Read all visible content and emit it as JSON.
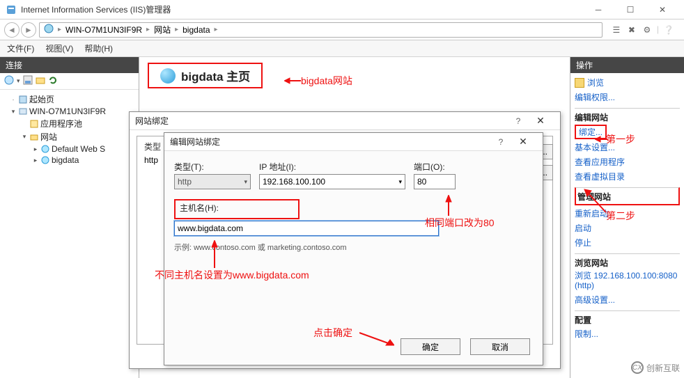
{
  "window": {
    "title": "Internet Information Services (IIS)管理器"
  },
  "breadcrumbs": {
    "server": "WIN-O7M1UN3IF9R",
    "sites": "网站",
    "site": "bigdata"
  },
  "menu": {
    "file": "文件(F)",
    "view": "视图(V)",
    "help": "帮助(H)"
  },
  "left": {
    "header": "连接",
    "start_page": "起始页",
    "server": "WIN-O7M1UN3IF9R",
    "app_pools": "应用程序池",
    "sites": "网站",
    "default_site": "Default Web S",
    "bigdata": "bigdata"
  },
  "center": {
    "title": "bigdata 主页"
  },
  "right": {
    "header": "操作",
    "explore": "浏览",
    "edit_perm": "编辑权限...",
    "grp_edit_site": "编辑网站",
    "bindings": "绑定...",
    "basic_settings": "基本设置...",
    "view_apps": "查看应用程序",
    "view_vdirs": "查看虚拟目录",
    "grp_manage": "管理网站",
    "restart": "重新启动",
    "start": "启动",
    "stop": "停止",
    "grp_browse": "浏览网站",
    "browse_url": "浏览 192.168.100.100:8080 (http)",
    "adv_settings": "高级设置...",
    "grp_config": "配置",
    "limits": "限制..."
  },
  "dlg_bindings": {
    "title": "网站绑定",
    "col_type": "类型",
    "row_type": "http",
    "btn_placeholder": ")..."
  },
  "dlg_edit": {
    "title": "编辑网站绑定",
    "lbl_type": "类型(T):",
    "val_type": "http",
    "lbl_ip": "IP 地址(I):",
    "val_ip": "192.168.100.100",
    "lbl_port": "端口(O):",
    "val_port": "80",
    "lbl_host": "主机名(H):",
    "val_host": "www.bigdata.com",
    "hint": "示例: www.contoso.com 或 marketing.contoso.com",
    "ok": "确定",
    "cancel": "取消"
  },
  "anno": {
    "a1": "bigdata网站",
    "a2": "第一步",
    "a3": "第二步",
    "a4": "相同端口改为80",
    "a5": "不同主机名设置为www.bigdata.com",
    "a6": "点击确定"
  },
  "watermark": "创新互联"
}
